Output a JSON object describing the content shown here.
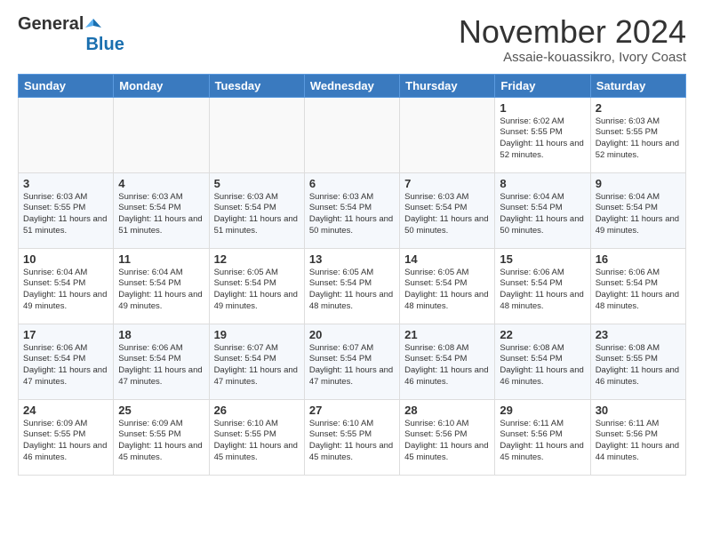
{
  "logo": {
    "general": "General",
    "blue": "Blue"
  },
  "title": "November 2024",
  "subtitle": "Assaie-kouassikro, Ivory Coast",
  "weekdays": [
    "Sunday",
    "Monday",
    "Tuesday",
    "Wednesday",
    "Thursday",
    "Friday",
    "Saturday"
  ],
  "weeks": [
    [
      {
        "day": "",
        "info": ""
      },
      {
        "day": "",
        "info": ""
      },
      {
        "day": "",
        "info": ""
      },
      {
        "day": "",
        "info": ""
      },
      {
        "day": "",
        "info": ""
      },
      {
        "day": "1",
        "info": "Sunrise: 6:02 AM\nSunset: 5:55 PM\nDaylight: 11 hours and 52 minutes."
      },
      {
        "day": "2",
        "info": "Sunrise: 6:03 AM\nSunset: 5:55 PM\nDaylight: 11 hours and 52 minutes."
      }
    ],
    [
      {
        "day": "3",
        "info": "Sunrise: 6:03 AM\nSunset: 5:55 PM\nDaylight: 11 hours and 51 minutes."
      },
      {
        "day": "4",
        "info": "Sunrise: 6:03 AM\nSunset: 5:54 PM\nDaylight: 11 hours and 51 minutes."
      },
      {
        "day": "5",
        "info": "Sunrise: 6:03 AM\nSunset: 5:54 PM\nDaylight: 11 hours and 51 minutes."
      },
      {
        "day": "6",
        "info": "Sunrise: 6:03 AM\nSunset: 5:54 PM\nDaylight: 11 hours and 50 minutes."
      },
      {
        "day": "7",
        "info": "Sunrise: 6:03 AM\nSunset: 5:54 PM\nDaylight: 11 hours and 50 minutes."
      },
      {
        "day": "8",
        "info": "Sunrise: 6:04 AM\nSunset: 5:54 PM\nDaylight: 11 hours and 50 minutes."
      },
      {
        "day": "9",
        "info": "Sunrise: 6:04 AM\nSunset: 5:54 PM\nDaylight: 11 hours and 49 minutes."
      }
    ],
    [
      {
        "day": "10",
        "info": "Sunrise: 6:04 AM\nSunset: 5:54 PM\nDaylight: 11 hours and 49 minutes."
      },
      {
        "day": "11",
        "info": "Sunrise: 6:04 AM\nSunset: 5:54 PM\nDaylight: 11 hours and 49 minutes."
      },
      {
        "day": "12",
        "info": "Sunrise: 6:05 AM\nSunset: 5:54 PM\nDaylight: 11 hours and 49 minutes."
      },
      {
        "day": "13",
        "info": "Sunrise: 6:05 AM\nSunset: 5:54 PM\nDaylight: 11 hours and 48 minutes."
      },
      {
        "day": "14",
        "info": "Sunrise: 6:05 AM\nSunset: 5:54 PM\nDaylight: 11 hours and 48 minutes."
      },
      {
        "day": "15",
        "info": "Sunrise: 6:06 AM\nSunset: 5:54 PM\nDaylight: 11 hours and 48 minutes."
      },
      {
        "day": "16",
        "info": "Sunrise: 6:06 AM\nSunset: 5:54 PM\nDaylight: 11 hours and 48 minutes."
      }
    ],
    [
      {
        "day": "17",
        "info": "Sunrise: 6:06 AM\nSunset: 5:54 PM\nDaylight: 11 hours and 47 minutes."
      },
      {
        "day": "18",
        "info": "Sunrise: 6:06 AM\nSunset: 5:54 PM\nDaylight: 11 hours and 47 minutes."
      },
      {
        "day": "19",
        "info": "Sunrise: 6:07 AM\nSunset: 5:54 PM\nDaylight: 11 hours and 47 minutes."
      },
      {
        "day": "20",
        "info": "Sunrise: 6:07 AM\nSunset: 5:54 PM\nDaylight: 11 hours and 47 minutes."
      },
      {
        "day": "21",
        "info": "Sunrise: 6:08 AM\nSunset: 5:54 PM\nDaylight: 11 hours and 46 minutes."
      },
      {
        "day": "22",
        "info": "Sunrise: 6:08 AM\nSunset: 5:54 PM\nDaylight: 11 hours and 46 minutes."
      },
      {
        "day": "23",
        "info": "Sunrise: 6:08 AM\nSunset: 5:55 PM\nDaylight: 11 hours and 46 minutes."
      }
    ],
    [
      {
        "day": "24",
        "info": "Sunrise: 6:09 AM\nSunset: 5:55 PM\nDaylight: 11 hours and 46 minutes."
      },
      {
        "day": "25",
        "info": "Sunrise: 6:09 AM\nSunset: 5:55 PM\nDaylight: 11 hours and 45 minutes."
      },
      {
        "day": "26",
        "info": "Sunrise: 6:10 AM\nSunset: 5:55 PM\nDaylight: 11 hours and 45 minutes."
      },
      {
        "day": "27",
        "info": "Sunrise: 6:10 AM\nSunset: 5:55 PM\nDaylight: 11 hours and 45 minutes."
      },
      {
        "day": "28",
        "info": "Sunrise: 6:10 AM\nSunset: 5:56 PM\nDaylight: 11 hours and 45 minutes."
      },
      {
        "day": "29",
        "info": "Sunrise: 6:11 AM\nSunset: 5:56 PM\nDaylight: 11 hours and 45 minutes."
      },
      {
        "day": "30",
        "info": "Sunrise: 6:11 AM\nSunset: 5:56 PM\nDaylight: 11 hours and 44 minutes."
      }
    ]
  ]
}
